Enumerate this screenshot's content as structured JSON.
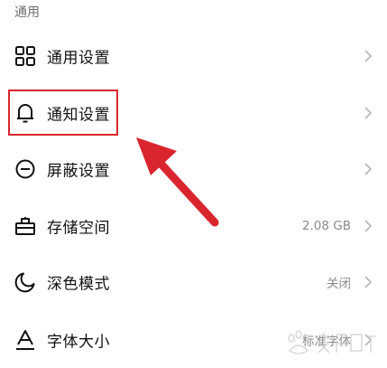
{
  "section": {
    "title": "通用"
  },
  "settings": [
    {
      "label": "通用设置",
      "icon": "grid-icon",
      "value": ""
    },
    {
      "label": "通知设置",
      "icon": "bell-icon",
      "value": ""
    },
    {
      "label": "屏蔽设置",
      "icon": "block-icon",
      "value": ""
    },
    {
      "label": "存储空间",
      "icon": "storage-box-icon",
      "value": "2.08 GB"
    },
    {
      "label": "深色模式",
      "icon": "moon-icon",
      "value": "关闭"
    },
    {
      "label": "字体大小",
      "icon": "font-size-icon",
      "value": "标准字体"
    }
  ],
  "annotation": {
    "highlight_color": "#d9262e",
    "arrow_color": "#d9262e"
  },
  "watermark": {
    "logo": "Baidu jingyan"
  }
}
